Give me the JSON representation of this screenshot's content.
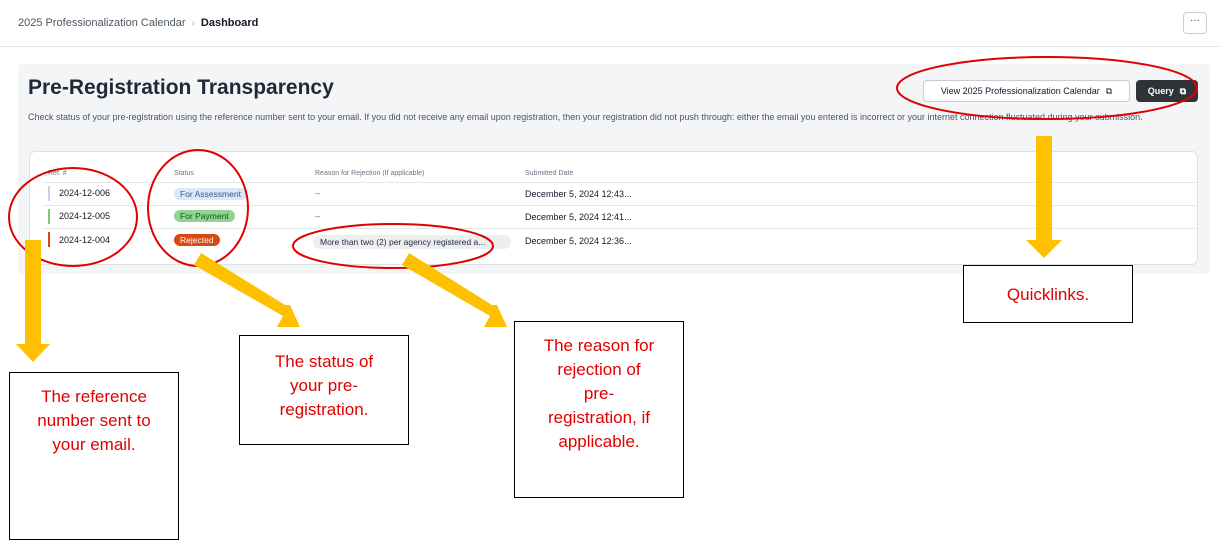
{
  "breadcrumb": {
    "parent": "2025 Professionalization Calendar",
    "current": "Dashboard"
  },
  "header": {
    "more_label": "···"
  },
  "panel": {
    "title": "Pre-Registration Transparency",
    "description": "Check status of your pre-registration using the reference number sent to your email. If you did not receive any email upon registration, then your registration did not push through: either the email you entered is incorrect or your internet connection fluctuated during your submission.",
    "buttons": {
      "calendar_label": "View 2025 Professionalization Calendar",
      "query_label": "Query"
    }
  },
  "table": {
    "columns": [
      "Ref. #",
      "Status",
      "Reason for Rejection (If applicable)",
      "Submitted Date"
    ],
    "rows": [
      {
        "ref": "2024-12-006",
        "status": "For Assessment",
        "reason": "–",
        "date": "December 5, 2024   12:43..."
      },
      {
        "ref": "2024-12-005",
        "status": "For Payment",
        "reason": "–",
        "date": "December 5, 2024   12:41..."
      },
      {
        "ref": "2024-12-004",
        "status": "Rejected",
        "reason": "More than two (2) per agency registered a...",
        "date": "December 5, 2024   12:36..."
      }
    ]
  },
  "colors": {
    "for_assessment_bg": "#dbe6f7",
    "for_assessment_text": "#3b5b8c",
    "for_payment_bg": "#8fd68c",
    "for_payment_text": "#14532d",
    "rejected_bg": "#d9480f",
    "rejected_text": "#ffffff",
    "annotation_red": "#e00000",
    "arrow_yellow": "#ffc000"
  },
  "annotations": {
    "ref_note": "The reference number sent to your email.",
    "status_note": "The status of your pre-registration.",
    "reason_note": "The reason for rejection of pre-registration, if applicable.",
    "quicklinks_note": "Quicklinks."
  }
}
